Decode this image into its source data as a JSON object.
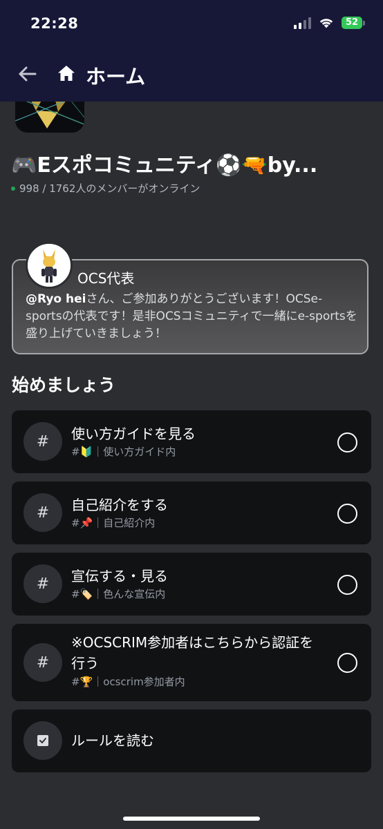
{
  "status_bar": {
    "time": "22:28",
    "battery": "52"
  },
  "header": {
    "title": "ホーム",
    "back_icon": "arrow-left-icon",
    "home_icon": "home-icon"
  },
  "server": {
    "name": "🎮Eスポコミュニティ⚽🔫by...",
    "online": "998 / 1762人のメンバーがオンライン"
  },
  "welcome": {
    "author": "OCS代表",
    "mention": "@Ryo hei",
    "message": "さん、ご参加ありがとうございます！OCSe-sportsの代表です！是非OCSコミュニティで一緒にe-sportsを盛り上げていきましょう！"
  },
  "getting_started": {
    "title": "始めましょう",
    "tasks": [
      {
        "icon": "#",
        "title": "使い方ガイドを見る",
        "subtitle": "#🔰｜使い方ガイド内"
      },
      {
        "icon": "#",
        "title": "自己紹介をする",
        "subtitle": "#📌｜自己紹介内"
      },
      {
        "icon": "#",
        "title": "宣伝する・見る",
        "subtitle": "#🏷️｜色んな宣伝内"
      },
      {
        "icon": "#",
        "title": "※OCSCRIM参加者はこちらから認証を行う",
        "subtitle": "#🏆｜ocscrim参加者内"
      },
      {
        "icon": "rules-icon",
        "title": "ルールを読む"
      }
    ]
  },
  "colors": {
    "nav_background": "#171838",
    "page_background": "#2b2d31",
    "card_background": "#111214",
    "online_green": "#23a55a",
    "battery_green": "#34c759"
  }
}
